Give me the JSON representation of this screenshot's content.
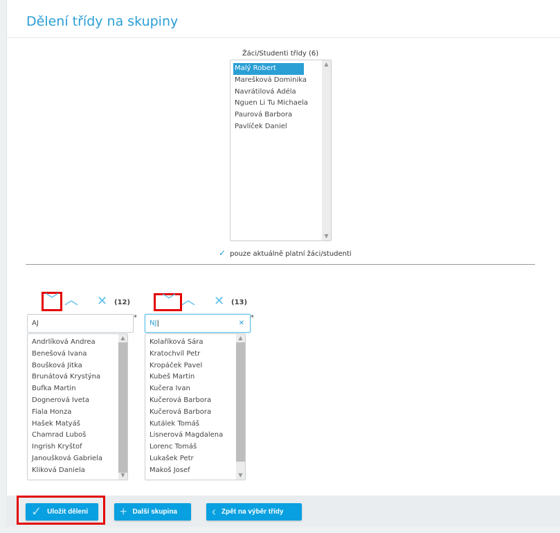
{
  "title": "Dělení třídy na skupiny",
  "source": {
    "label": "Žáci/Studenti třídy (6)",
    "items": [
      "Malý Robert",
      "Marešková Dominika",
      "Navrátilová Adéla",
      "Nguen Li Tu Michaela",
      "Paurová Barbora",
      "Pavlíček Daniel"
    ],
    "selected": "Malý Robert"
  },
  "only_current": {
    "label": "pouze aktuálně platní žáci/studenti",
    "checked": true
  },
  "groups": [
    {
      "count": "(12)",
      "name": "AJ",
      "required": "*",
      "items": [
        "Andrlíková Andrea",
        "Benešová Ivana",
        "Boušková Jitka",
        "Brunátová Krystýna",
        "Bufka Martin",
        "Dognerová Iveta",
        "Fiala Honza",
        "Hašek Matyáš",
        "Chamrad Luboš",
        "Ingrish Kryštof",
        "Janoušková Gabriela",
        "Kliková Daniela"
      ]
    },
    {
      "count": "(13)",
      "name": "NJ",
      "required": "*",
      "items": [
        "Kolaříková Sára",
        "Kratochvíl Petr",
        "Kropáček Pavel",
        "Kubeš Martin",
        "Kučera Ivan",
        "Kučerová Barbora",
        "Kučerová Barbora",
        "Kutálek Tomáš",
        "Lisnerová Magdalena",
        "Lorenc Tomáš",
        "Lukašek Petr",
        "Makoš Josef"
      ]
    }
  ],
  "footer": {
    "save": "Uložit dělení",
    "add": "Další skupina",
    "back": "Zpět na výběr třídy"
  },
  "colors": {
    "accent": "#2a9fd6",
    "button": "#08a0e0",
    "highlight": "#e30000"
  }
}
